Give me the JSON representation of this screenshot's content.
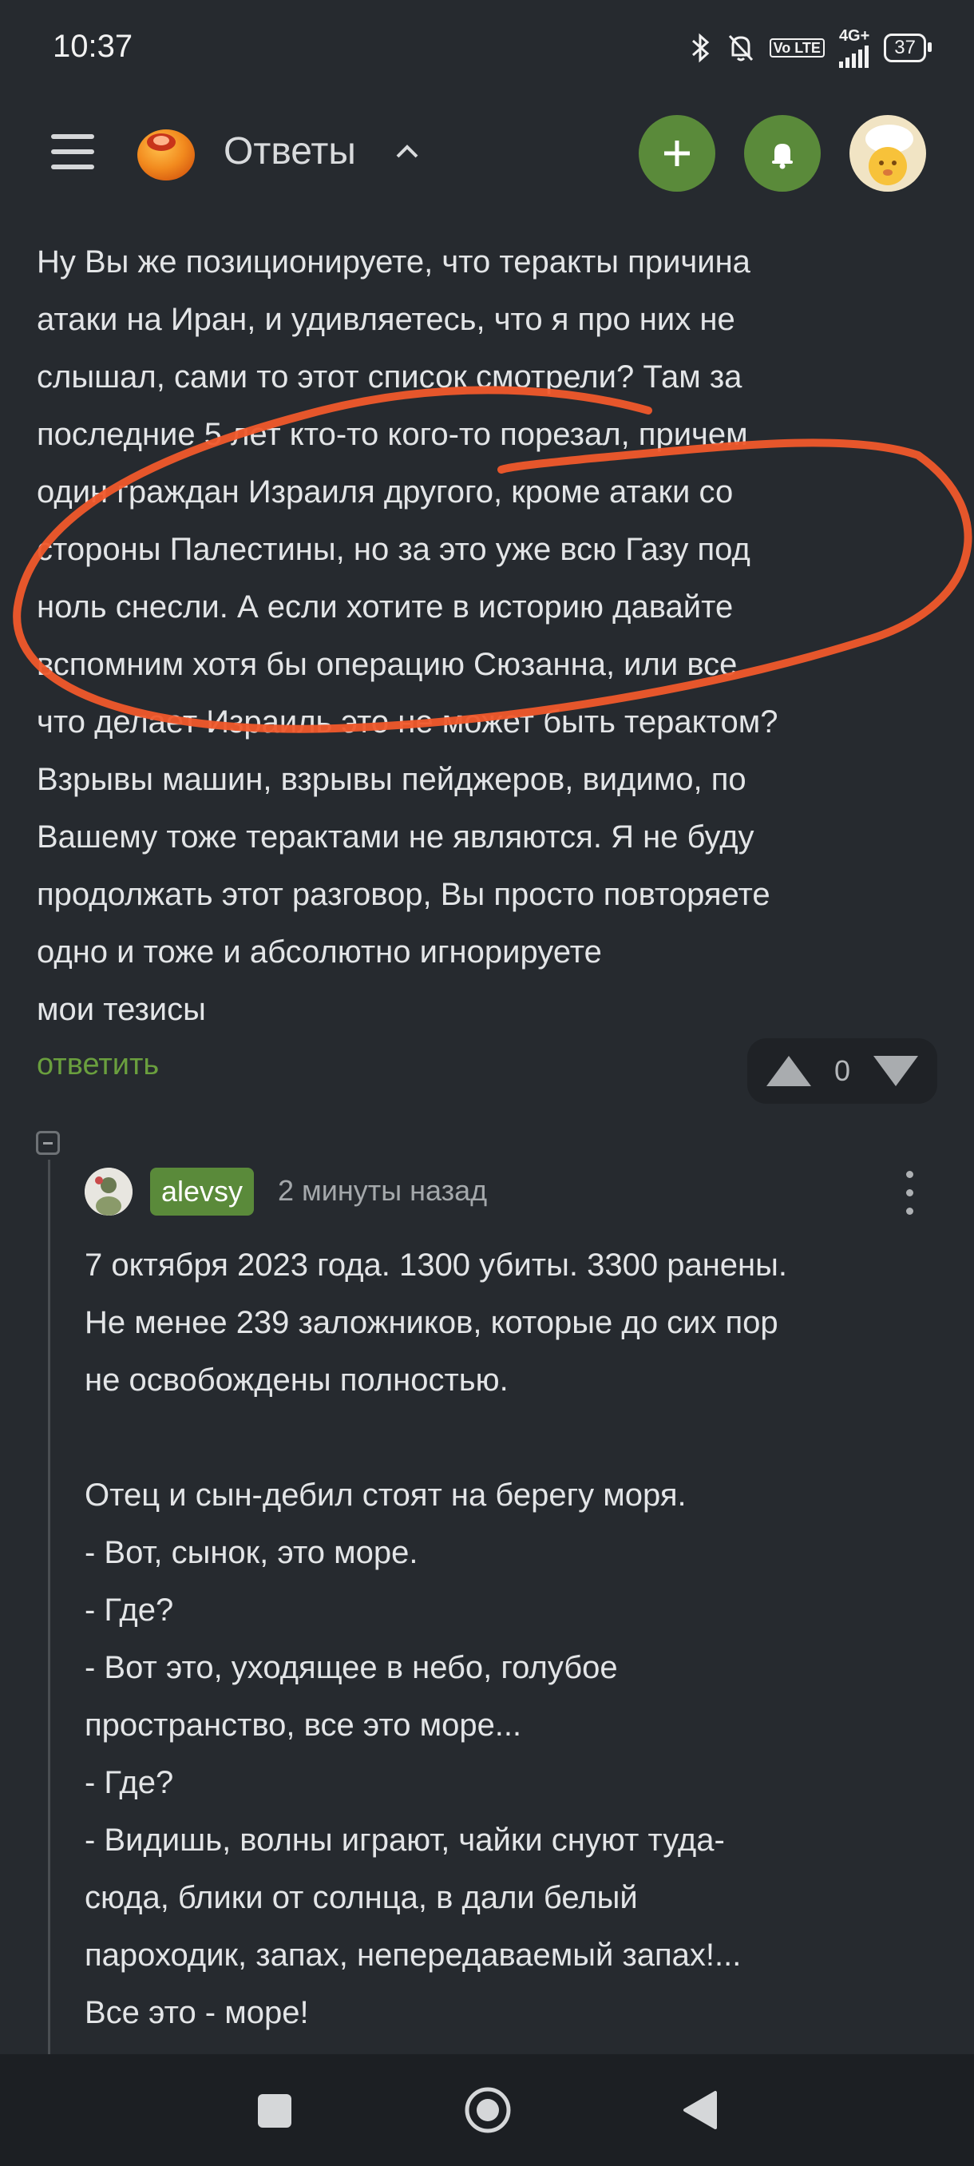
{
  "status_bar": {
    "time": "10:37",
    "network_badge": "Vo LTE",
    "network_type": "4G+",
    "battery": "37",
    "icons": [
      "bluetooth-icon",
      "bell-off-icon",
      "volte-icon",
      "signal-icon",
      "battery-icon"
    ]
  },
  "header": {
    "title": "Ответы",
    "icons": [
      "menu-icon",
      "logo-icon",
      "chevron-up-icon",
      "plus-icon",
      "bell-icon",
      "avatar"
    ],
    "accent": "#5a8a3a"
  },
  "comment_main": {
    "lines": [
      "Ну Вы же позиционируете, что теракты причина",
      "атаки на Иран, и удивляетесь, что я про них не",
      "слышал, сами то этот список смотрели? Там за",
      "последние 5 лет кто-то кого-то порезал, причем",
      "один граждан Израиля другого, кроме атаки со",
      "стороны Палестины, но за это уже всю Газу под",
      "ноль снесли. А если хотите в историю давайте",
      "вспомним хотя бы операцию Сюзанна, или все",
      "что делает Израиль это не может быть терактом?",
      "Взрывы машин, взрывы пейджеров, видимо, по",
      "Вашему тоже терактами не являются. Я не буду",
      "продолжать этот разговор, Вы просто повторяете",
      "одно и тоже и абсолютно игнорируете",
      "мои тезисы"
    ],
    "reply_label": "ответить",
    "vote_count": "0"
  },
  "reply_comment": {
    "username": "alevsy",
    "time": "2 минуты назад",
    "lines": [
      "7 октября 2023 года. 1300 убиты. 3300 ранены.",
      "Не менее 239 заложников, которые до сих пор",
      "не освобождены полностью.",
      "",
      "Отец и сын-дебил стоят на берегу моря.",
      "- Вот, сынок, это море.",
      "- Где?",
      "- Вот это, уходящее в небо, голубое",
      "пространство, все это море...",
      "- Где?",
      "- Видишь, волны играют, чайки снуют туда-",
      "сюда, блики от солнца, в дали белый",
      "пароходик, запах, непередаваемый запах!...",
      "Все это - море!"
    ]
  },
  "annotation": {
    "color": "#f0592b"
  },
  "nav_bar": {
    "icons": [
      "recents-square-icon",
      "home-circle-icon",
      "back-triangle-icon"
    ]
  }
}
